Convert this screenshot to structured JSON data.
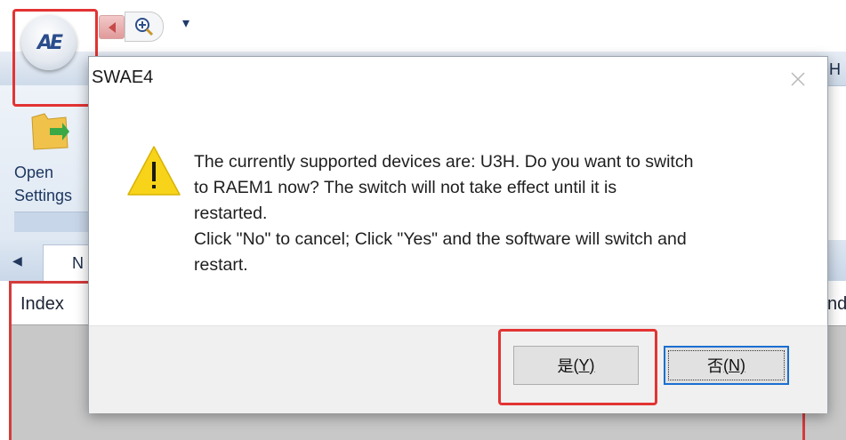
{
  "app": {
    "logo_text": "AE",
    "quick_access": {
      "dropdown_glyph": "▾"
    },
    "right_tab_partial": "H",
    "ribbon": {
      "open_settings_label": "Open\nSettings"
    },
    "doc_tabs": {
      "scroll_left_glyph": "◀",
      "active_tab_partial": "N"
    },
    "grid": {
      "index_header": "Index",
      "right_header_partial": "nd"
    }
  },
  "dialog": {
    "title": "SWAE4",
    "close_glyph": "✕",
    "icon": "warning-icon",
    "message": "The currently supported devices are: U3H. Do you want to switch\nto RAEM1 now? The switch will not take effect until it is\nrestarted.\nClick \"No\" to cancel; Click \"Yes\" and the software will switch and\nrestart.",
    "buttons": {
      "yes": {
        "label": "是",
        "mnemonic": "(Y)"
      },
      "no": {
        "label": "否",
        "mnemonic": "(N)"
      }
    }
  },
  "colors": {
    "highlight": "#e33333",
    "focus_border": "#1a6fd1",
    "warning": "#f7d31a"
  }
}
